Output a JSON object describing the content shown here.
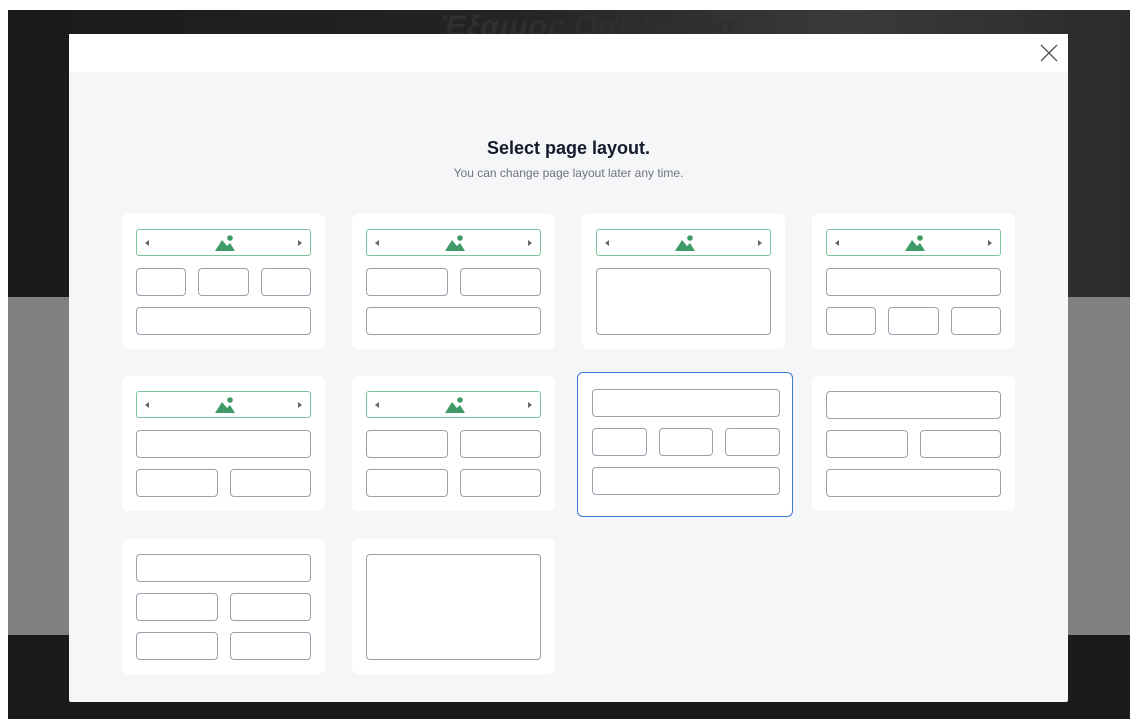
{
  "background": {
    "title": "Έξαιμος Οαί δυσσα"
  },
  "modal": {
    "heading": "Select page layout.",
    "subheading": "You can change page layout later any time."
  },
  "layouts": [
    {
      "id": "layout-1",
      "slider": true,
      "rows": [
        3,
        1
      ],
      "selected": false
    },
    {
      "id": "layout-2",
      "slider": true,
      "rows": [
        2,
        1
      ],
      "selected": false
    },
    {
      "id": "layout-3",
      "slider": true,
      "rows": [
        "big"
      ],
      "selected": false
    },
    {
      "id": "layout-4",
      "slider": true,
      "rows": [
        1,
        3
      ],
      "selected": false
    },
    {
      "id": "layout-5",
      "slider": true,
      "rows": [
        1,
        2
      ],
      "selected": false
    },
    {
      "id": "layout-6",
      "slider": true,
      "rows": [
        2,
        2
      ],
      "selected": false
    },
    {
      "id": "layout-7",
      "slider": false,
      "rows": [
        1,
        3,
        1
      ],
      "selected": true
    },
    {
      "id": "layout-8",
      "slider": false,
      "rows": [
        1,
        2,
        1
      ],
      "selected": false
    },
    {
      "id": "layout-9",
      "slider": false,
      "rows": [
        1,
        2,
        2
      ],
      "selected": false
    },
    {
      "id": "layout-10",
      "slider": false,
      "rows": [
        "big"
      ],
      "selected": false
    }
  ],
  "colors": {
    "accent": "#3a78d4",
    "slider_border": "#7cc49a",
    "image_icon": "#3e9a67"
  }
}
